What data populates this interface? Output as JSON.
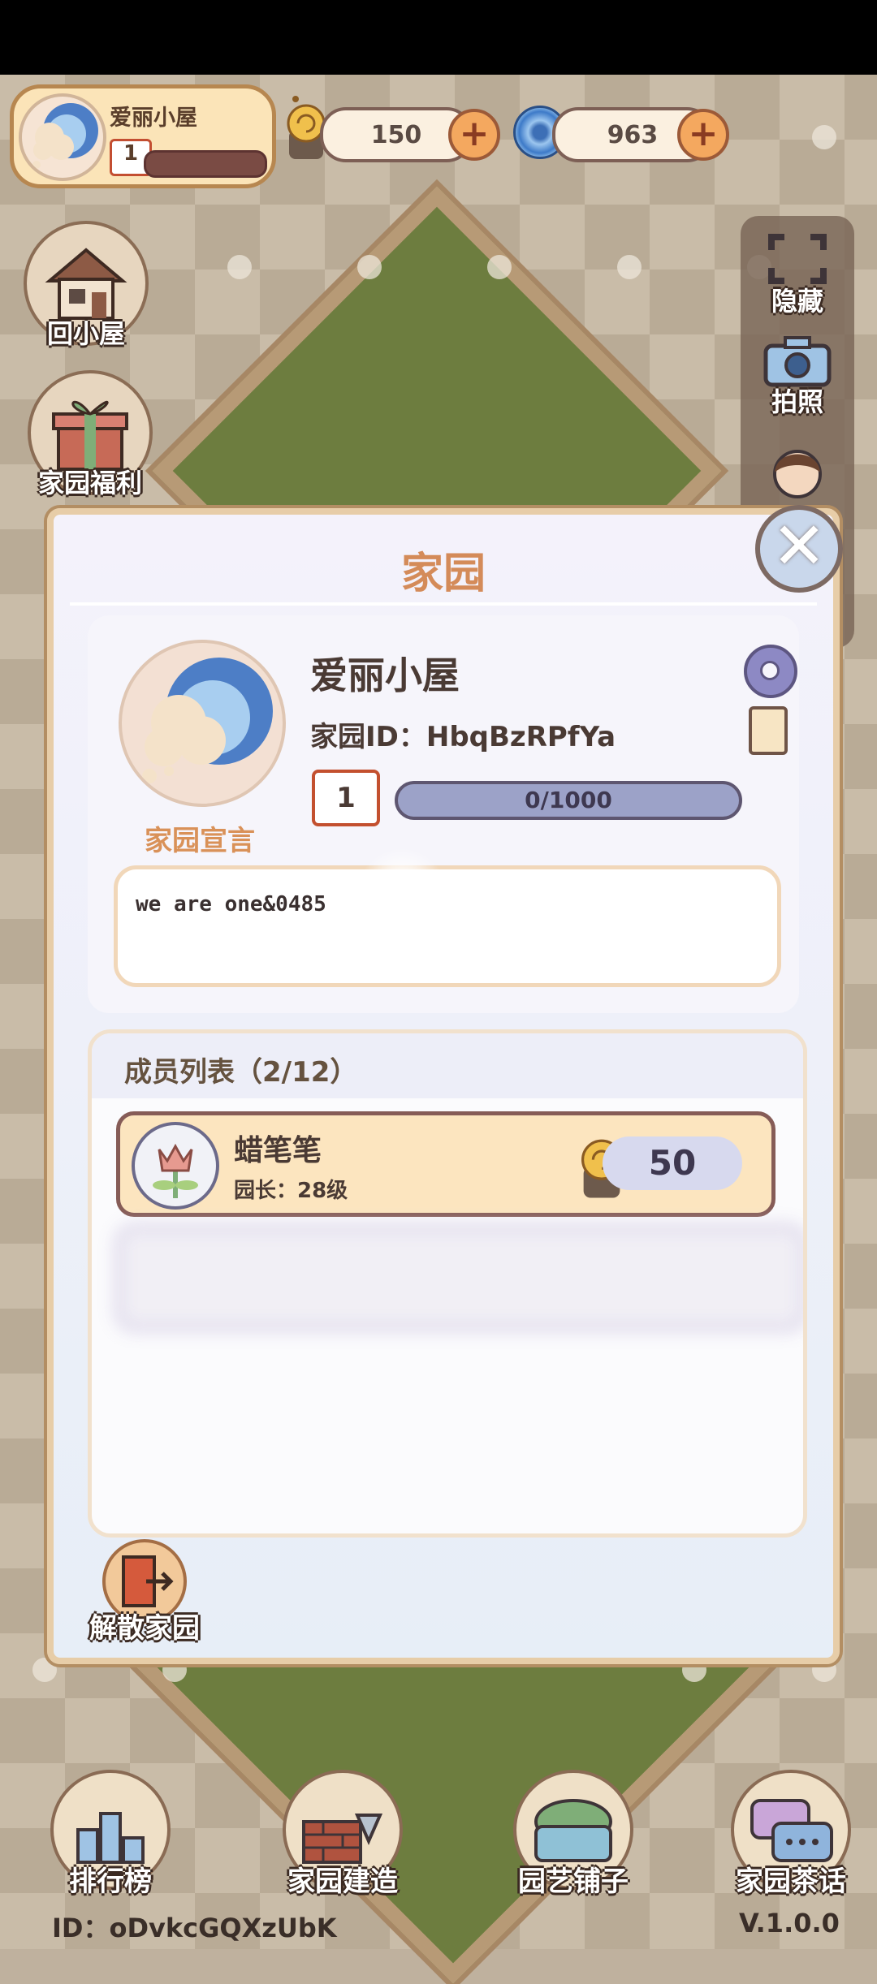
{
  "hud": {
    "home_name": "爱丽小屋",
    "home_level": "1",
    "snail_count": "150",
    "gem_count": "963"
  },
  "left_buttons": {
    "back_home": "回小屋",
    "welfare": "家园福利"
  },
  "right_panel": {
    "hide": "隐藏",
    "photo": "拍照"
  },
  "dialog": {
    "title": "家园",
    "home_name": "爱丽小屋",
    "home_id": "家园ID：HbqBzRPfYa",
    "level": "1",
    "exp": "0/1000",
    "motto_label": "家园宣言",
    "motto": "we are one&0485",
    "members_title": "成员列表（2/12）",
    "members": [
      {
        "name": "蜡笔笔",
        "role": "园长：28级",
        "score": "50"
      }
    ],
    "dissolve": "解散家园"
  },
  "bottom_nav": {
    "rank": "排行榜",
    "build": "家园建造",
    "shop": "园艺铺子",
    "chat": "家园茶话"
  },
  "footer": {
    "id": "ID：oDvkcGQXzUbK",
    "version": "V.1.0.0"
  },
  "colors": {
    "accent": "#d48b59",
    "exp_bar": "#9ca2c8",
    "level_border": "#c3502f"
  }
}
